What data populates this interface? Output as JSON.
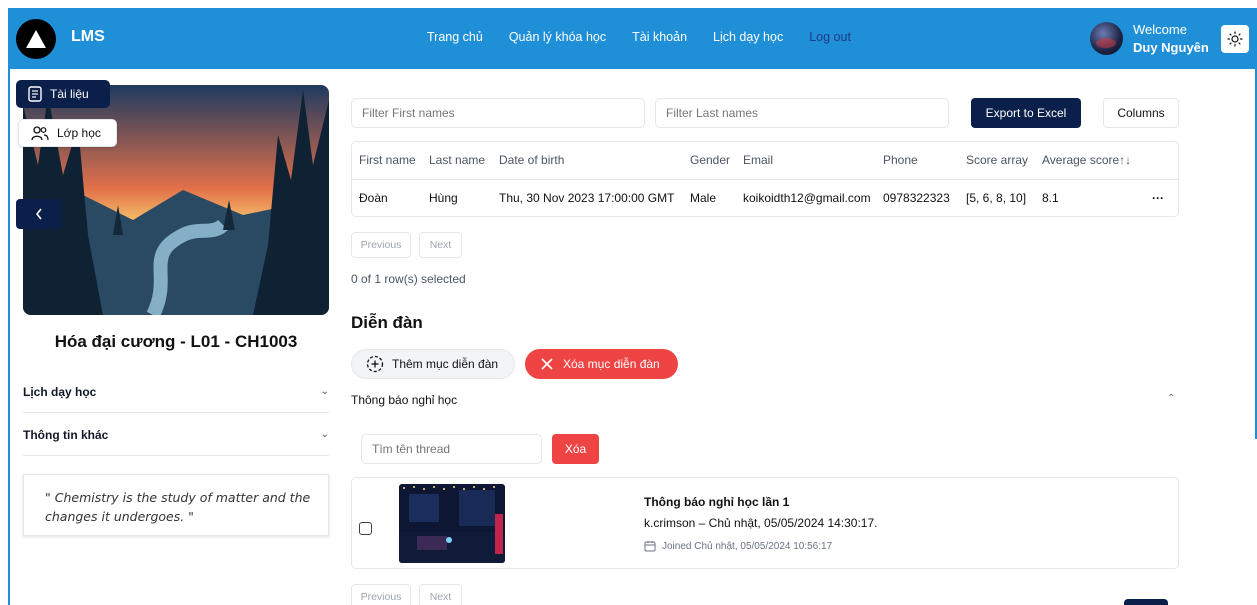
{
  "header": {
    "brand": "LMS",
    "nav": [
      "Trang chủ",
      "Quản lý khóa học",
      "Tài khoản",
      "Lịch dạy học",
      "Log out"
    ],
    "welcome": "Welcome",
    "user_name": "Duy Nguyên"
  },
  "sidebar": {
    "doc_label": "Tài liệu",
    "class_label": "Lớp học",
    "course_title": "Hóa đại cương - L01 - CH1003",
    "accordion": [
      "Lịch dạy học",
      "Thông tin khác"
    ],
    "quote": "\" Chemistry is the study of matter and the changes it undergoes. \""
  },
  "table": {
    "filter_first_placeholder": "Filter First names",
    "filter_last_placeholder": "Filter Last names",
    "export_label": "Export to Excel",
    "columns_label": "Columns",
    "headers": [
      "First name",
      "Last name",
      "Date of birth",
      "Gender",
      "Email",
      "Phone",
      "Score array",
      "Average score"
    ],
    "sort_icon": "↑↓",
    "rows": [
      [
        "Đoàn",
        "Hùng",
        "Thu, 30 Nov 2023 17:00:00 GMT",
        "Male",
        "koikoidth12@gmail.com",
        "0978322323",
        "[5, 6, 8, 10]",
        "8.1"
      ]
    ],
    "row_menu": "···",
    "prev_label": "Previous",
    "next_label": "Next",
    "selected_text": "0 of 1 row(s) selected"
  },
  "forum": {
    "title": "Diễn đàn",
    "add_label": "Thêm mục diễn đàn",
    "delete_label": "Xóa mục diễn đàn",
    "section_label": "Thông báo nghỉ học",
    "search_placeholder": "Tìm tên thread",
    "search_button": "Xóa",
    "thread": {
      "title": "Thông báo nghỉ học lần 1",
      "meta": "k.crimson – Chủ nhật, 05/05/2024 14:30:17.",
      "joined": "Joined Chủ nhật, 05/05/2024 10:56:17"
    },
    "prev_label": "Previous",
    "next_label": "Next"
  },
  "colors": {
    "header_blue": "#1f8fd8",
    "navy": "#0b1f4b",
    "danger": "#ef4444"
  }
}
